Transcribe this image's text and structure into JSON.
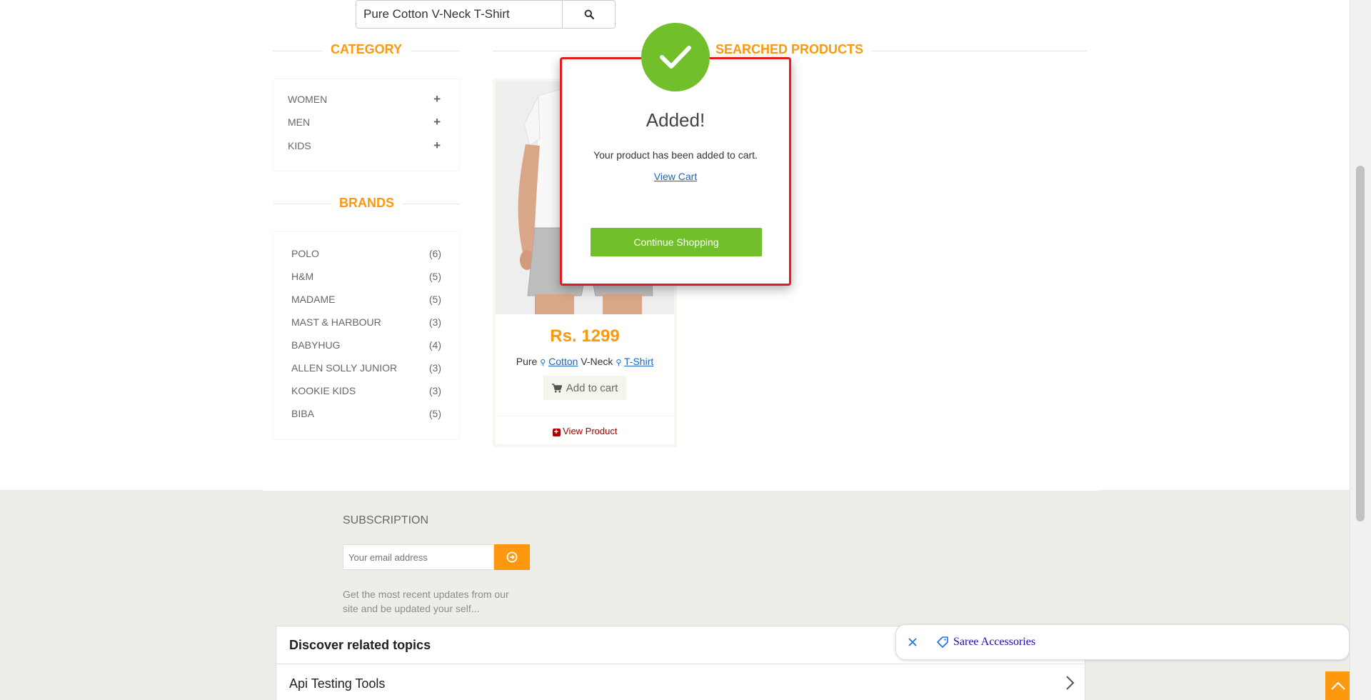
{
  "search": {
    "value": "Pure Cotton V-Neck T-Shirt",
    "icon": "search-icon"
  },
  "sidebar": {
    "category_title": "CATEGORY",
    "categories": [
      {
        "label": "WOMEN",
        "icon": "plus-icon"
      },
      {
        "label": "MEN",
        "icon": "plus-icon"
      },
      {
        "label": "KIDS",
        "icon": "plus-icon"
      }
    ],
    "brands_title": "BRANDS",
    "brands": [
      {
        "name": "POLO",
        "count": "(6)"
      },
      {
        "name": "H&M",
        "count": "(5)"
      },
      {
        "name": "MADAME",
        "count": "(5)"
      },
      {
        "name": "MAST & HARBOUR",
        "count": "(3)"
      },
      {
        "name": "BABYHUG",
        "count": "(4)"
      },
      {
        "name": "ALLEN SOLLY JUNIOR",
        "count": "(3)"
      },
      {
        "name": "KOOKIE KIDS",
        "count": "(3)"
      },
      {
        "name": "BIBA",
        "count": "(5)"
      }
    ]
  },
  "main": {
    "title": "SEARCHED PRODUCTS",
    "product": {
      "price": "Rs. 1299",
      "name_parts": [
        "Pure",
        "Cotton",
        "V-Neck",
        "T-Shirt"
      ],
      "add_to_cart": "Add to cart",
      "view_product": "View Product"
    }
  },
  "modal": {
    "title": "Added!",
    "message": "Your product has been added to cart.",
    "view_cart": "View Cart",
    "continue_button": "Continue Shopping",
    "icon": "check-icon"
  },
  "footer": {
    "subscription_title": "SUBSCRIPTION",
    "email_placeholder": "Your email address",
    "description": "Get the most recent updates from our site and be updated your self..."
  },
  "related": {
    "title": "Discover related topics",
    "items": [
      "Api Testing Tools"
    ]
  },
  "chip": {
    "label": "Saree Accessories"
  },
  "colors": {
    "accent": "#FE980F",
    "success": "#71C02B",
    "modal_border": "#e31b23"
  }
}
